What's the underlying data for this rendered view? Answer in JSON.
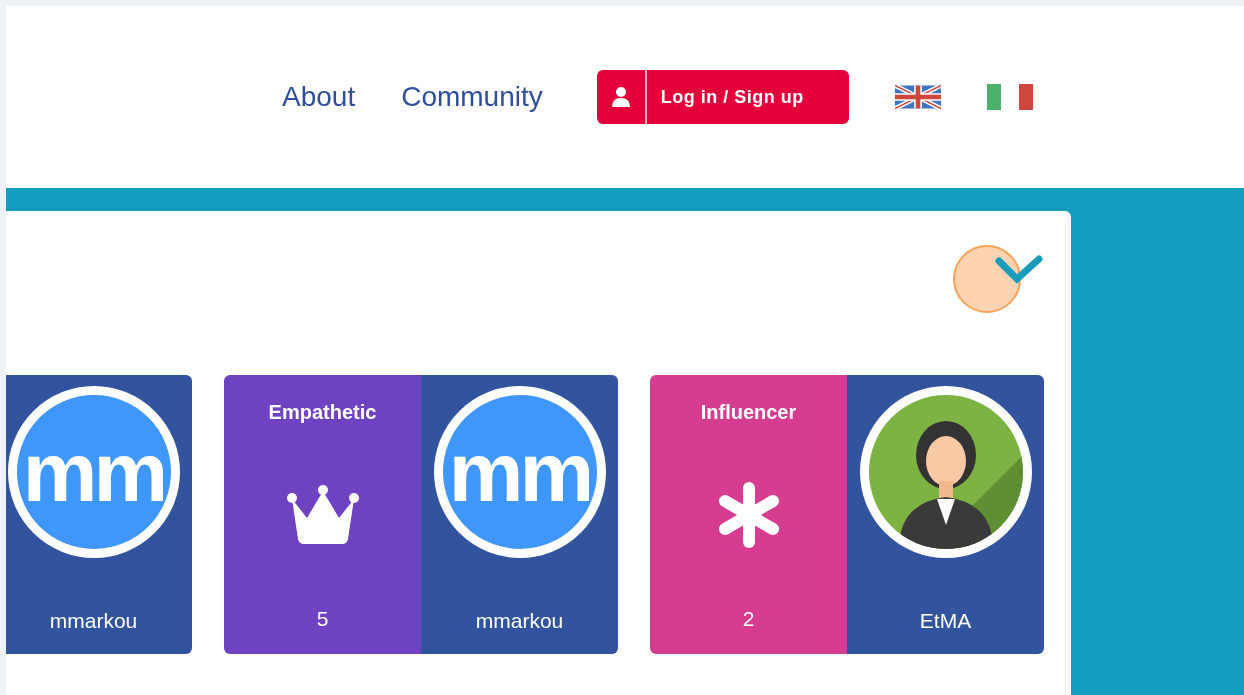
{
  "nav": {
    "links": [
      {
        "label": "About"
      },
      {
        "label": "Community"
      }
    ],
    "login_button": {
      "label": "Log in / Sign up"
    },
    "languages": [
      {
        "kind": "uk"
      },
      {
        "kind": "it"
      }
    ]
  },
  "cards": [
    {
      "user": {
        "name": "mmarkou",
        "kind": "initials",
        "initials": "mm"
      }
    },
    {
      "badge": {
        "label": "Empathetic",
        "kind": "crown",
        "count": "5",
        "color": "#6f42c1"
      },
      "user": {
        "name": "mmarkou",
        "kind": "initials",
        "initials": "mm"
      }
    },
    {
      "badge": {
        "label": "Influencer",
        "kind": "asterisk",
        "count": "2",
        "color": "#d63d91"
      },
      "user": {
        "name": "EtMA",
        "kind": "person"
      }
    }
  ]
}
